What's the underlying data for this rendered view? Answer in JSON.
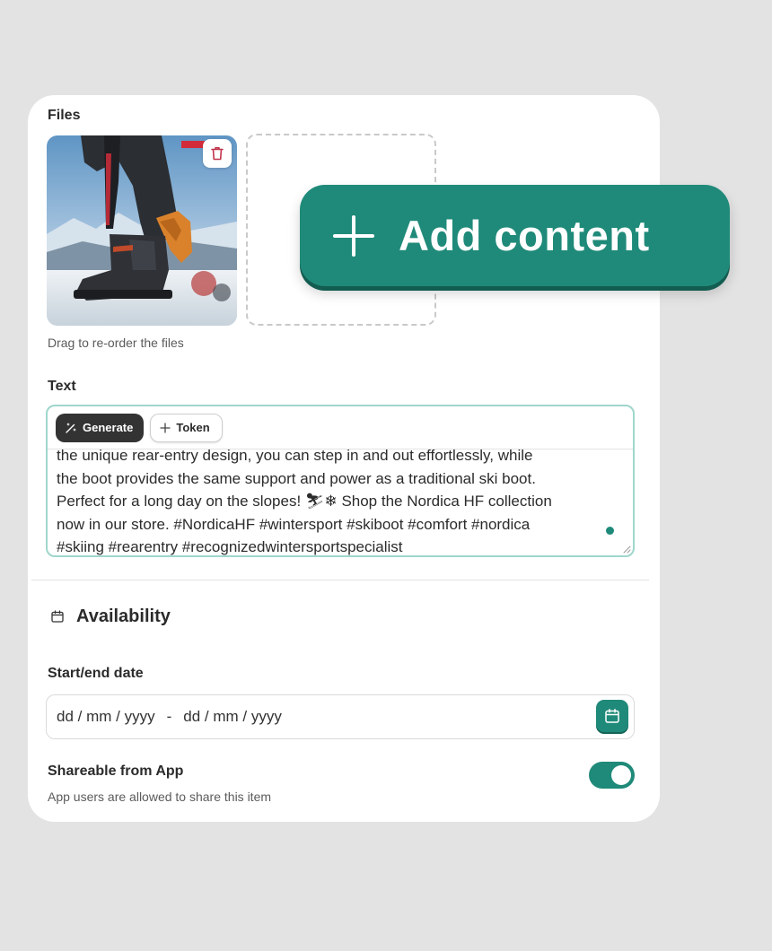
{
  "files": {
    "heading": "Files",
    "hint": "Drag to re-order the files"
  },
  "text": {
    "heading": "Text",
    "generate_label": "Generate",
    "token_label": "Token",
    "content": "the unique rear-entry design, you can step in and out effortlessly, while\nthe boot provides the same support and power as a traditional ski boot.\nPerfect for a long day on the slopes! ⛷❄ Shop the Nordica HF collection\nnow in our store. #NordicaHF #wintersport #skiboot #comfort #nordica\n#skiing #rearentry #recognizedwintersportspecialist"
  },
  "availability": {
    "heading": "Availability",
    "date_label": "Start/end date",
    "start_placeholder": "dd / mm / yyyy",
    "separator": "-",
    "end_placeholder": "dd / mm / yyyy"
  },
  "shareable": {
    "label": "Shareable from App",
    "description": "App users are allowed to share this item",
    "enabled": true
  },
  "add_content": {
    "label": "Add content"
  },
  "colors": {
    "accent": "#1f8a79",
    "background": "#e3e3e3",
    "card": "#ffffff",
    "delete": "#c0344a"
  }
}
